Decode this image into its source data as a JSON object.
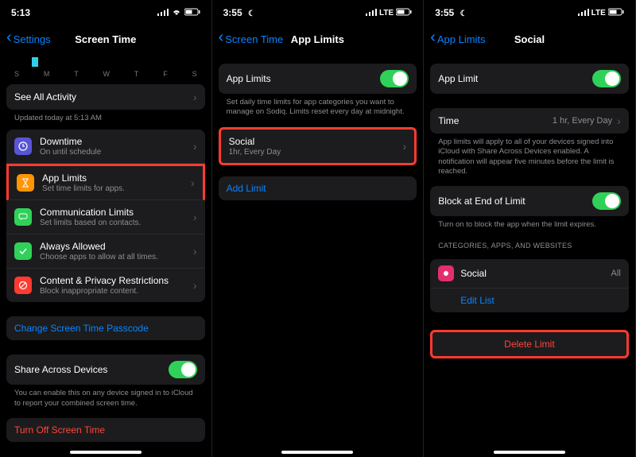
{
  "accent_blue": "#0a84ff",
  "accent_red": "#ff453a",
  "accent_green": "#30d158",
  "screen1": {
    "time": "5:13",
    "back": "Settings",
    "title": "Screen Time",
    "days": [
      "S",
      "M",
      "T",
      "W",
      "T",
      "F",
      "S"
    ],
    "see_all": "See All Activity",
    "updated": "Updated today at 5:13 AM",
    "rows": {
      "downtime": {
        "title": "Downtime",
        "sub": "On until schedule"
      },
      "applimits": {
        "title": "App Limits",
        "sub": "Set time limits for apps."
      },
      "comm": {
        "title": "Communication Limits",
        "sub": "Set limits based on contacts."
      },
      "allowed": {
        "title": "Always Allowed",
        "sub": "Choose apps to allow at all times."
      },
      "content": {
        "title": "Content & Privacy Restrictions",
        "sub": "Block inappropriate content."
      }
    },
    "change_passcode": "Change Screen Time Passcode",
    "share": "Share Across Devices",
    "share_note": "You can enable this on any device signed in to iCloud to report your combined screen time.",
    "turn_off": "Turn Off Screen Time"
  },
  "screen2": {
    "time": "3:55",
    "carrier": "LTE",
    "back": "Screen Time",
    "title": "App Limits",
    "toggle_label": "App Limits",
    "note": "Set daily time limits for app categories you want to manage on Sodiq. Limits reset every day at midnight.",
    "social": {
      "title": "Social",
      "sub": "1hr, Every Day"
    },
    "add": "Add Limit"
  },
  "screen3": {
    "time": "3:55",
    "carrier": "LTE",
    "back": "App Limits",
    "title": "Social",
    "toggle_label": "App Limit",
    "time_label": "Time",
    "time_value": "1 hr, Every Day",
    "time_note": "App limits will apply to all of your devices signed into iCloud with Share Across Devices enabled. A notification will appear five minutes before the limit is reached.",
    "block_label": "Block at End of Limit",
    "block_note": "Turn on to block the app when the limit expires.",
    "cat_header": "CATEGORIES, APPS, AND WEBSITES",
    "cat_item": "Social",
    "cat_value": "All",
    "edit_list": "Edit List",
    "delete": "Delete Limit"
  }
}
